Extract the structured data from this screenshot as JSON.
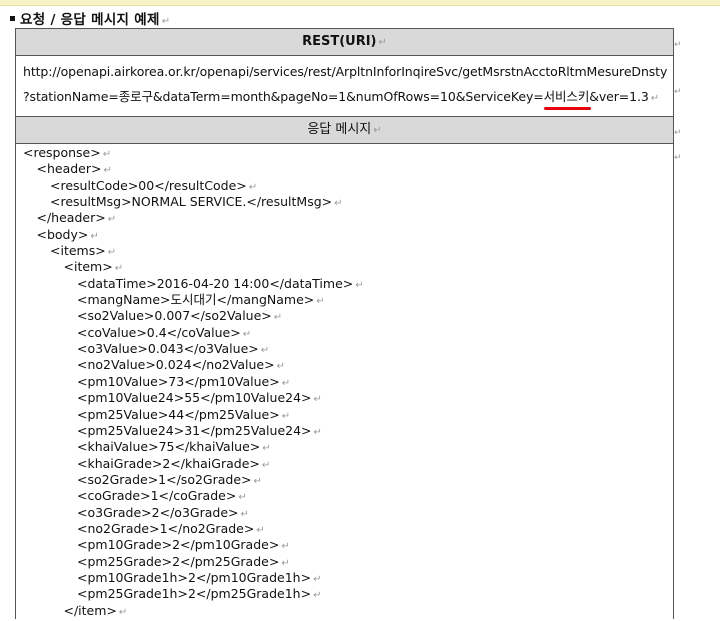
{
  "heading": "요청 / 응답 메시지 예제",
  "para_mark": "↵",
  "rest_header": "REST(URI)",
  "url_line1": "http://openapi.airkorea.or.kr/openapi/services/rest/ArpltnInforInqireSvc/getMsrstnAcctoRltmMesureDnsty",
  "url_line2_before": "?stationName=종로구&dataTerm=month&pageNo=1&numOfRows=10&ServiceKey=",
  "url_line2_key": "서비스키",
  "url_line2_after": "&ver=1.3",
  "response_header": "응답 메시지",
  "code_lines": [
    {
      "indent": 0,
      "text": "<response>"
    },
    {
      "indent": 1,
      "text": "<header>"
    },
    {
      "indent": 2,
      "text": "<resultCode>00</resultCode>"
    },
    {
      "indent": 2,
      "text": "<resultMsg>NORMAL SERVICE.</resultMsg>"
    },
    {
      "indent": 1,
      "text": "</header>"
    },
    {
      "indent": 1,
      "text": "<body>"
    },
    {
      "indent": 2,
      "text": "<items>"
    },
    {
      "indent": 3,
      "text": "<item>"
    },
    {
      "indent": 4,
      "text": "<dataTime>2016-04-20 14:00</dataTime>"
    },
    {
      "indent": 4,
      "text": "<mangName>도시대기</mangName>"
    },
    {
      "indent": 4,
      "text": "<so2Value>0.007</so2Value>"
    },
    {
      "indent": 4,
      "text": "<coValue>0.4</coValue>"
    },
    {
      "indent": 4,
      "text": "<o3Value>0.043</o3Value>"
    },
    {
      "indent": 4,
      "text": "<no2Value>0.024</no2Value>"
    },
    {
      "indent": 4,
      "text": "<pm10Value>73</pm10Value>"
    },
    {
      "indent": 4,
      "text": "<pm10Value24>55</pm10Value24>"
    },
    {
      "indent": 4,
      "text": "<pm25Value>44</pm25Value>"
    },
    {
      "indent": 4,
      "text": "<pm25Value24>31</pm25Value24>"
    },
    {
      "indent": 4,
      "text": "<khaiValue>75</khaiValue>"
    },
    {
      "indent": 4,
      "text": "<khaiGrade>2</khaiGrade>"
    },
    {
      "indent": 4,
      "text": "<so2Grade>1</so2Grade>"
    },
    {
      "indent": 4,
      "text": "<coGrade>1</coGrade>"
    },
    {
      "indent": 4,
      "text": "<o3Grade>2</o3Grade>"
    },
    {
      "indent": 4,
      "text": "<no2Grade>1</no2Grade>"
    },
    {
      "indent": 4,
      "text": "<pm10Grade>2</pm10Grade>"
    },
    {
      "indent": 4,
      "text": "<pm25Grade>2</pm25Grade>"
    },
    {
      "indent": 4,
      "text": "<pm10Grade1h>2</pm10Grade1h>"
    },
    {
      "indent": 4,
      "text": "<pm25Grade1h>2</pm25Grade1h>"
    },
    {
      "indent": 3,
      "text": "</item>"
    }
  ],
  "colors": {
    "underline": "#e8000b",
    "header_bg": "#d9d9d9"
  }
}
